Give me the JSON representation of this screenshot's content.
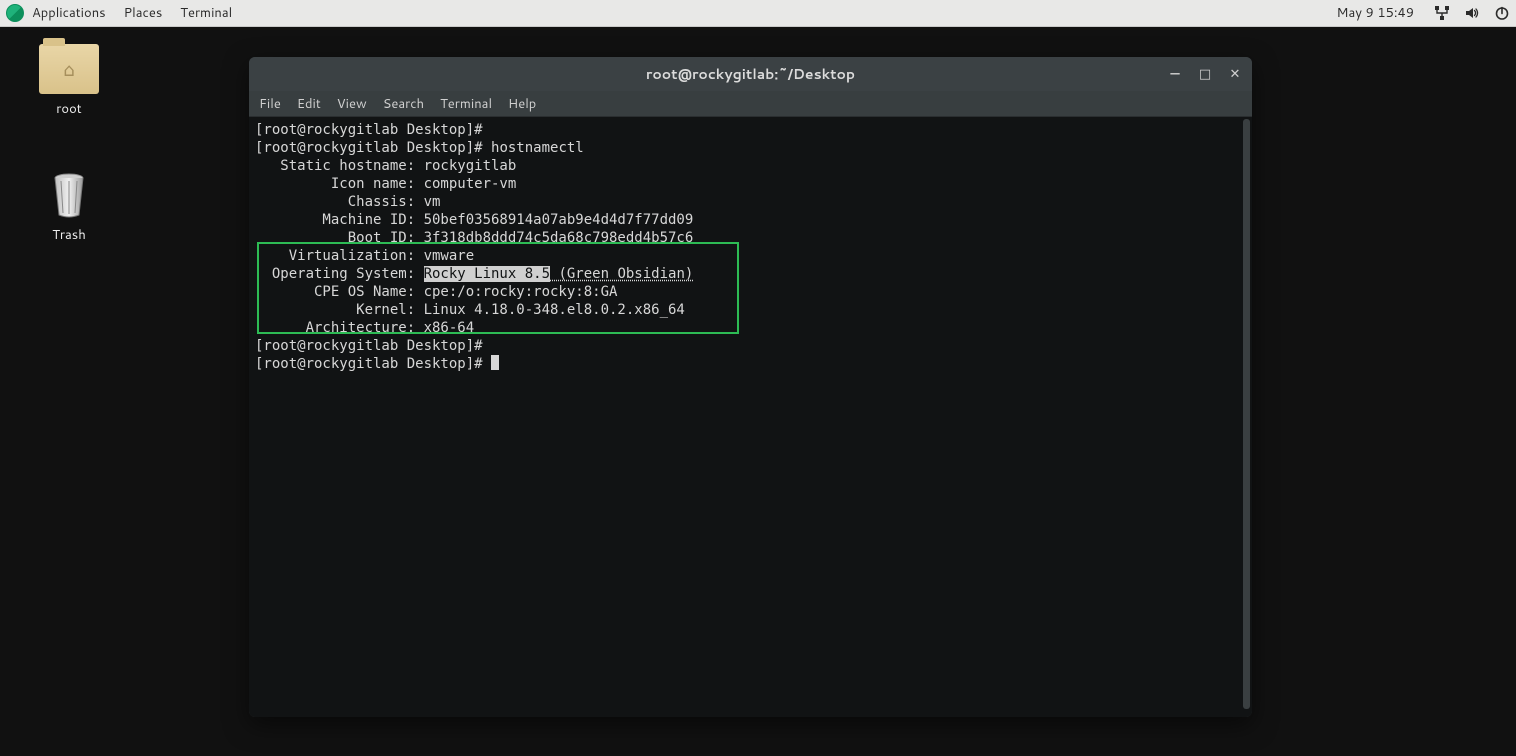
{
  "topbar": {
    "menus": [
      "Applications",
      "Places",
      "Terminal"
    ],
    "clock": "May 9  15:49"
  },
  "desktop": {
    "root_label": "root",
    "trash_label": "Trash"
  },
  "term": {
    "title": "root@rockygitlab:~/Desktop",
    "menus": [
      "File",
      "Edit",
      "View",
      "Search",
      "Terminal",
      "Help"
    ],
    "prompt": "[root@rockygitlab Desktop]#",
    "prompt_sp": "[root@rockygitlab Desktop]# ",
    "cmd": "hostnamectl",
    "out": {
      "l1": "   Static hostname: rockygitlab",
      "l2": "         Icon name: computer-vm",
      "l3": "           Chassis: vm",
      "l4": "        Machine ID: 50bef03568914a07ab9e4d4d7f77dd09",
      "l5": "           Boot ID: 3f318db8ddd74c5da68c798edd4b57c6",
      "l6": "    Virtualization: vmware",
      "l7a": "  Operating System: ",
      "l7b": "Rocky Linux 8.5",
      "l7c": " (Green Obsidian)",
      "l8": "       CPE OS Name: cpe:/o:rocky:rocky:8:GA",
      "l9": "            Kernel: Linux 4.18.0-348.el8.0.2.x86_64",
      "l10": "      Architecture: x86-64"
    }
  }
}
